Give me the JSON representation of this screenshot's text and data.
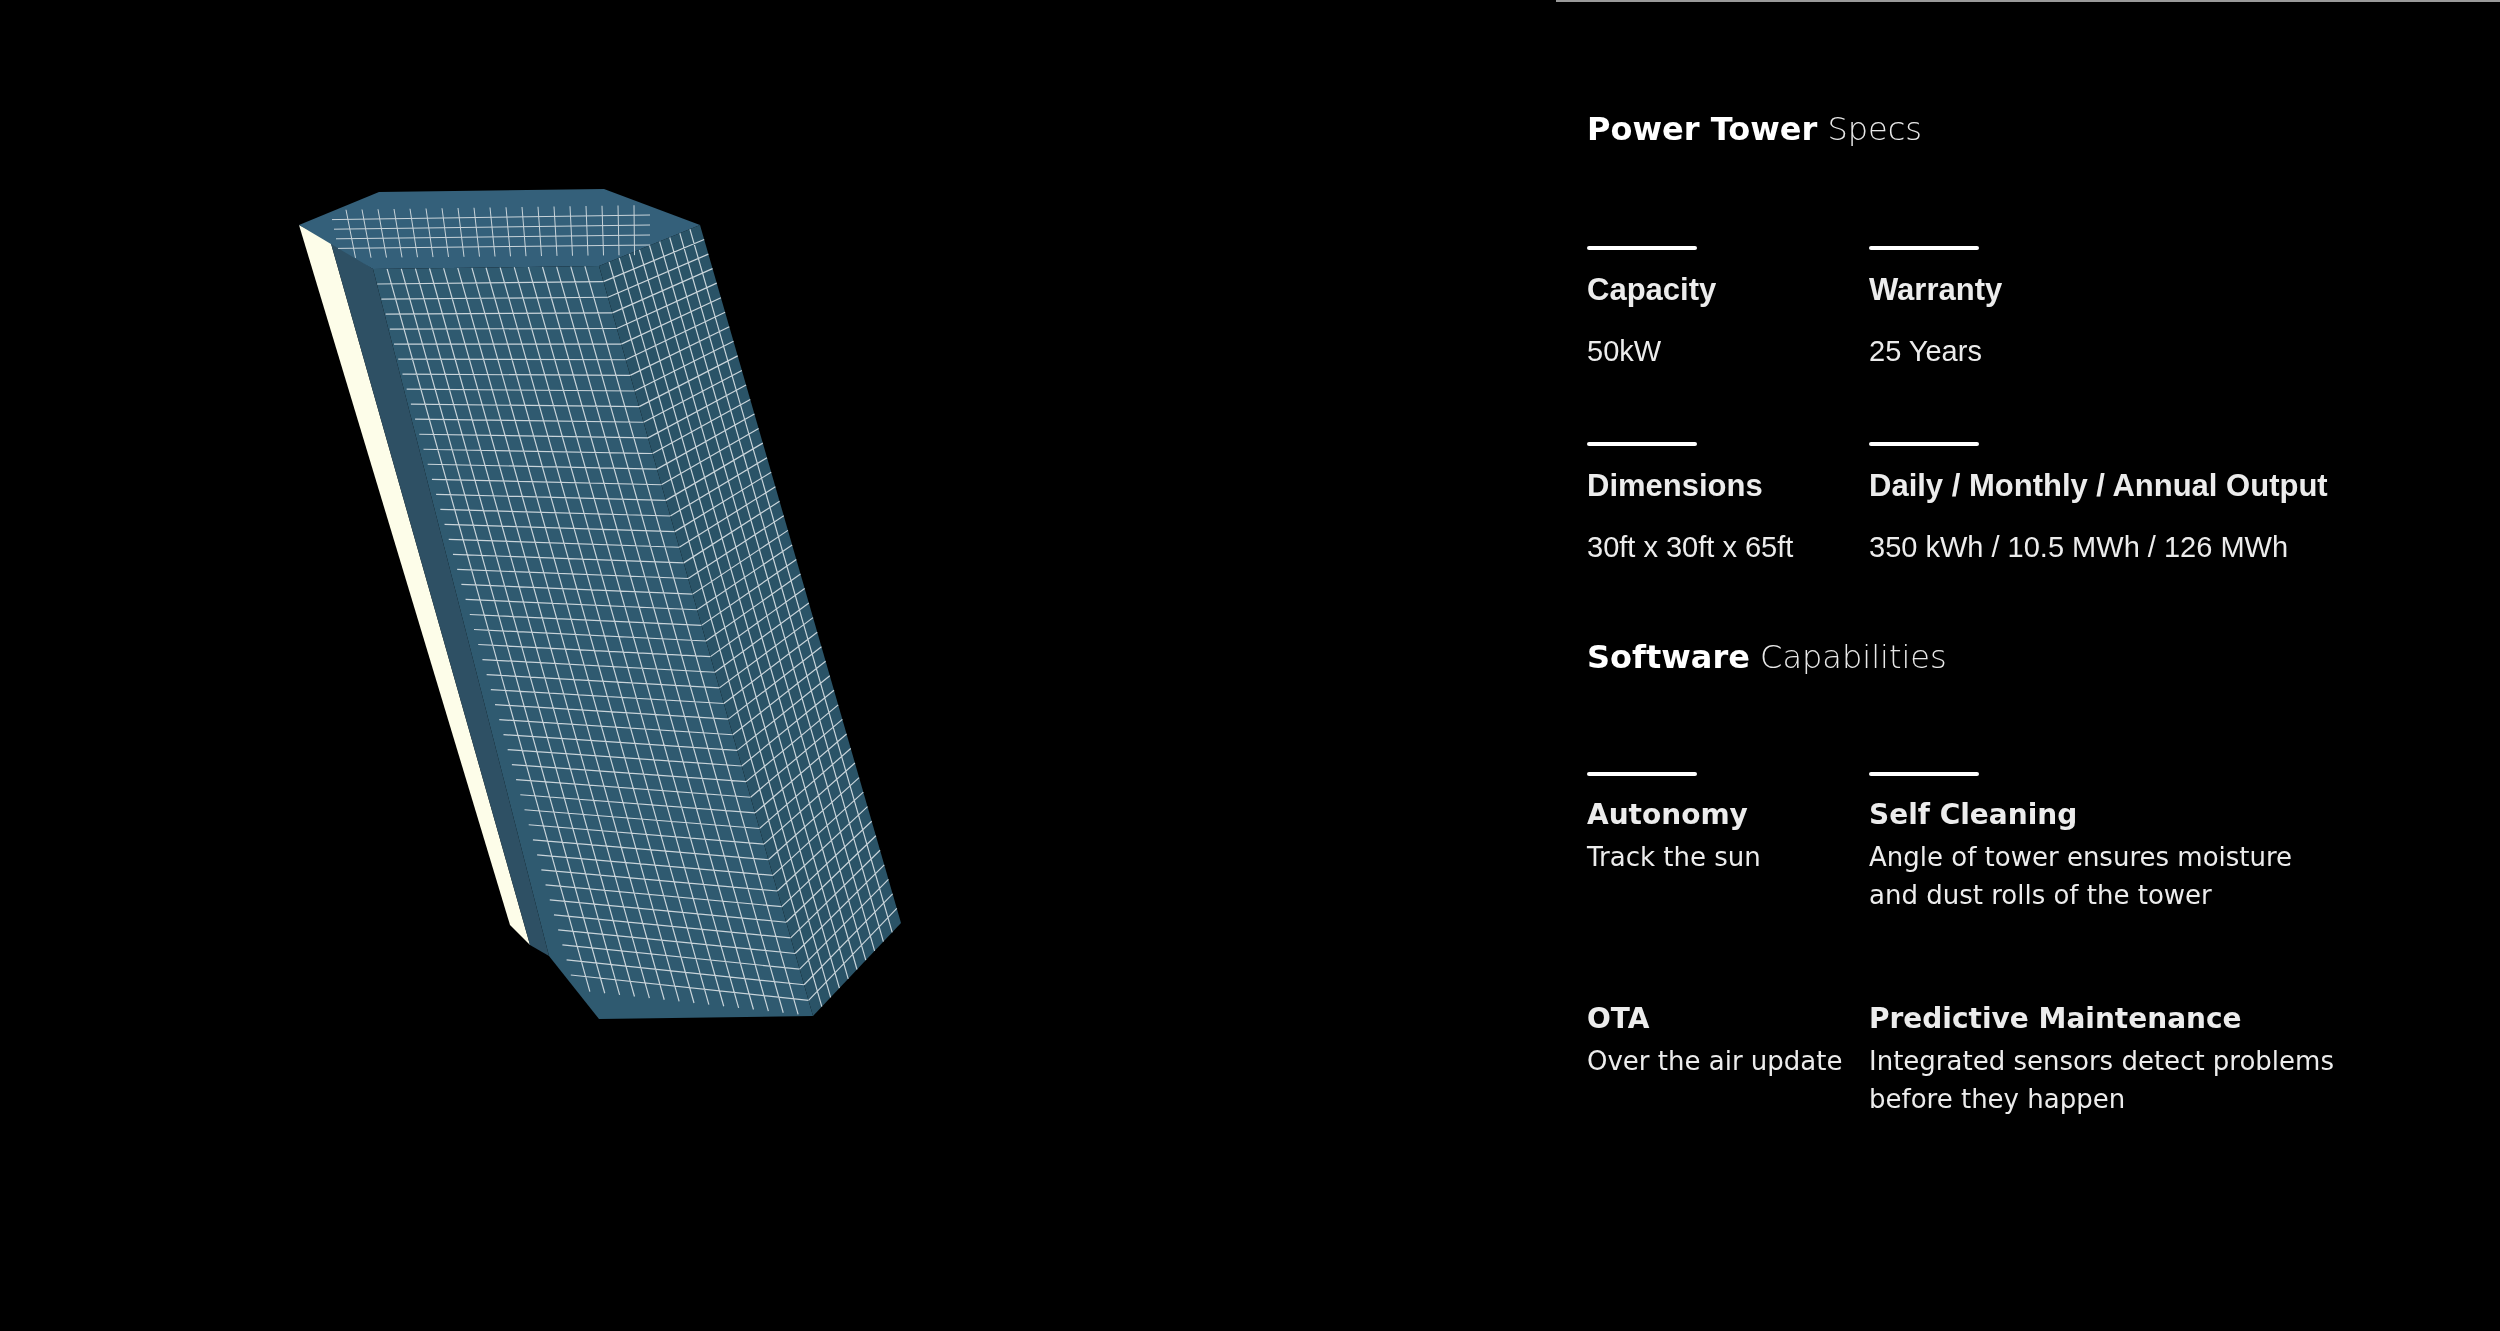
{
  "sections": [
    {
      "kind": "spec",
      "title_bold": "Power Tower",
      "title_light": "Specs",
      "items": [
        {
          "label": "Capacity",
          "lines": [
            "50kW"
          ],
          "rule": true
        },
        {
          "label": "Warranty",
          "lines": [
            "25 Years"
          ],
          "rule": true
        },
        {
          "label": "Dimensions",
          "lines": [
            "30ft x 30ft x 65ft"
          ],
          "rule": true
        },
        {
          "label": "Daily / Monthly / Annual Output",
          "lines": [
            "350 kWh / 10.5 MWh / 126 MWh"
          ],
          "rule": true
        }
      ]
    },
    {
      "kind": "capability",
      "title_bold": "Software",
      "title_light": "Capabilities",
      "items": [
        {
          "label": "Autonomy",
          "lines": [
            "Track the sun"
          ],
          "rule": true
        },
        {
          "label": "Self Cleaning",
          "lines": [
            "Angle of tower ensures moisture",
            "and dust rolls of the tower"
          ],
          "rule": true
        },
        {
          "label": "OTA",
          "lines": [
            "Over the air update"
          ],
          "rule": false
        },
        {
          "label": "Predictive Maintenance",
          "lines": [
            "Integrated sensors detect problems",
            "before they happen"
          ],
          "rule": false
        }
      ]
    }
  ]
}
